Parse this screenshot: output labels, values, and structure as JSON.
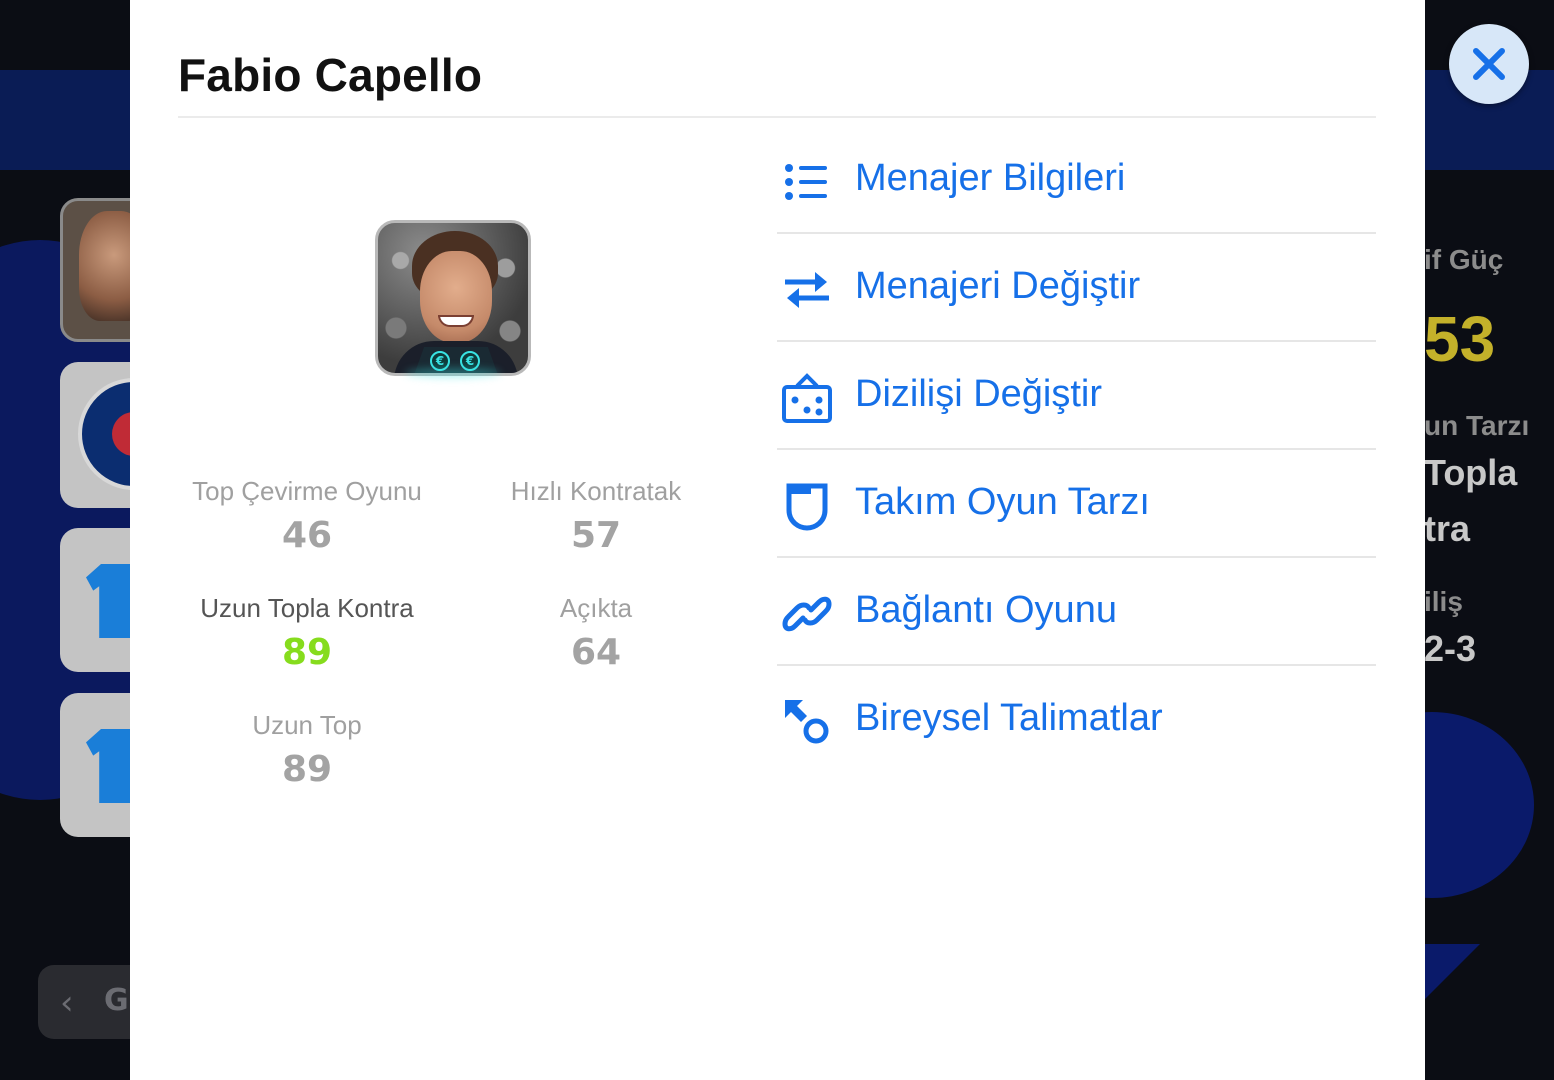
{
  "modal": {
    "title": "Fabio Capello",
    "stats": [
      {
        "label": "Top Çevirme Oyunu",
        "value": "46",
        "active": false,
        "highlight": false
      },
      {
        "label": "Hızlı Kontratak",
        "value": "57",
        "active": false,
        "highlight": false
      },
      {
        "label": "Uzun Topla Kontra",
        "value": "89",
        "active": true,
        "highlight": true
      },
      {
        "label": "Açıkta",
        "value": "64",
        "active": false,
        "highlight": false
      },
      {
        "label": "Uzun Top",
        "value": "89",
        "active": false,
        "highlight": false
      }
    ],
    "avatar_badges": [
      "€",
      "€"
    ],
    "menu": [
      {
        "label": "Menajer Bilgileri",
        "icon": "list-icon"
      },
      {
        "label": "Menajeri Değiştir",
        "icon": "swap-arrows-icon"
      },
      {
        "label": "Dizilişi Değiştir",
        "icon": "formation-board-icon"
      },
      {
        "label": "Takım Oyun Tarzı",
        "icon": "shield-icon"
      },
      {
        "label": "Bağlantı Oyunu",
        "icon": "link-icon"
      },
      {
        "label": "Bireysel Talimatlar",
        "icon": "individual-instructions-icon"
      }
    ],
    "close_icon": "close-icon"
  },
  "background": {
    "right_panel": {
      "label_1": "if Güç",
      "value_1": "53",
      "label_2": "un Tarzı",
      "value_2a": "Topla",
      "value_2b": "tra",
      "label_3": "iliş",
      "value_3": "2-3"
    },
    "back_button_text": "G"
  },
  "colors": {
    "accent": "#1670e8",
    "highlight": "#86dc1d",
    "muted": "#a3a3a3",
    "background_yellow": "#c4b12a"
  }
}
